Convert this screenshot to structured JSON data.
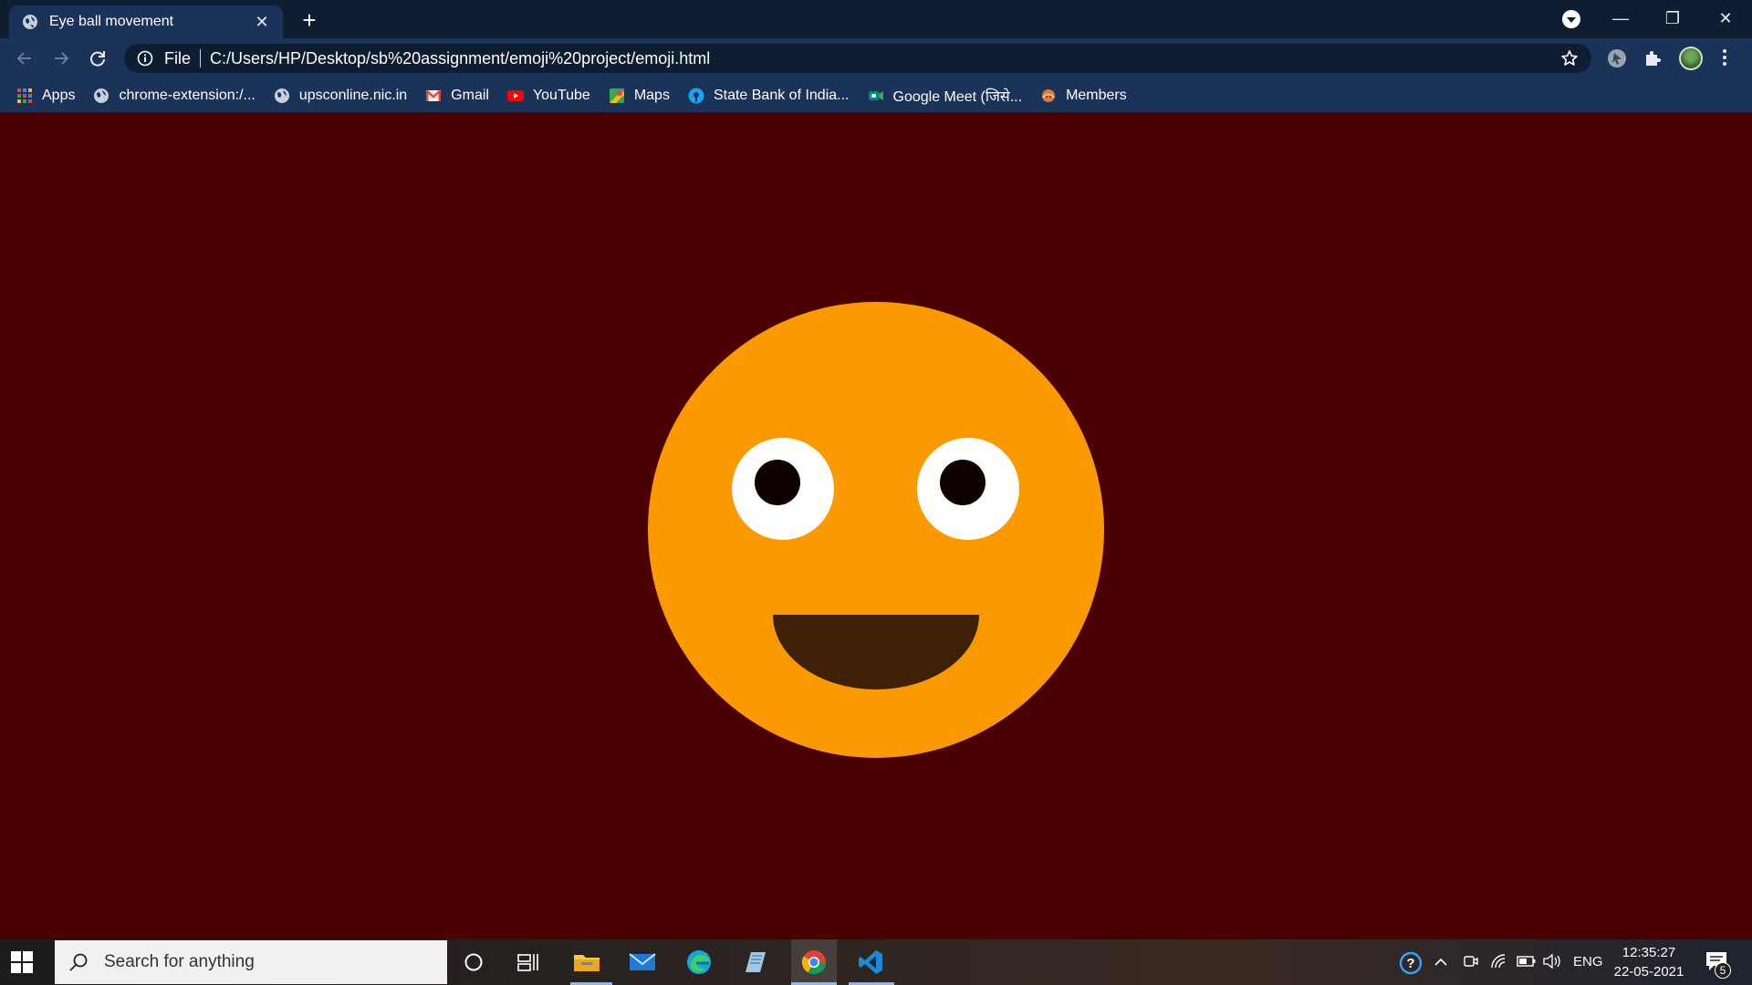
{
  "browser": {
    "tab_title": "Eye ball movement",
    "new_tab_label": "+",
    "window_controls": {
      "minimize": "—",
      "restore": "❐",
      "close": "✕"
    },
    "omnibox": {
      "scheme_label": "File",
      "url": "C:/Users/HP/Desktop/sb%20assignment/emoji%20project/emoji.html"
    }
  },
  "bookmarks": [
    {
      "label": "Apps",
      "icon": "apps-grid-icon"
    },
    {
      "label": "chrome-extension:/...",
      "icon": "globe-icon"
    },
    {
      "label": "upsconline.nic.in",
      "icon": "globe-icon"
    },
    {
      "label": "Gmail",
      "icon": "gmail-icon"
    },
    {
      "label": "YouTube",
      "icon": "youtube-icon"
    },
    {
      "label": "Maps",
      "icon": "maps-icon"
    },
    {
      "label": "State Bank of India...",
      "icon": "sbi-icon"
    },
    {
      "label": "Google Meet (जिसे...",
      "icon": "meet-icon"
    },
    {
      "label": "Members",
      "icon": "members-icon"
    }
  ],
  "page": {
    "background_color": "#4a0000",
    "emoji": {
      "face_color": "#fa9a00",
      "eye_color": "#ffffff",
      "pupil_color": "#0f0000",
      "mouth_color": "#3d2005"
    }
  },
  "taskbar": {
    "search_placeholder": "Search for anything",
    "language": "ENG",
    "time": "12:35:27",
    "date": "22-05-2021",
    "notification_count": "5"
  }
}
